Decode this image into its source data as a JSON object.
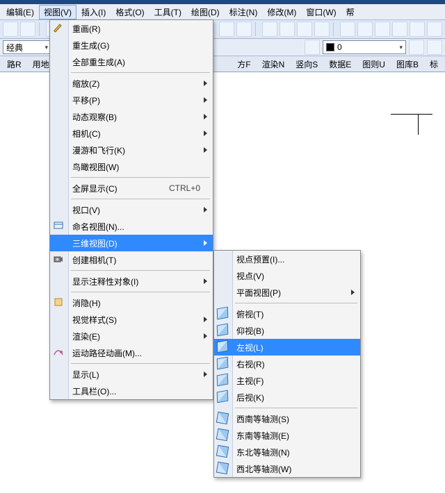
{
  "menubar": {
    "edit": "编辑(E)",
    "view": "视图(V)",
    "insert": "插入(I)",
    "format": "格式(O)",
    "tools": "工具(T)",
    "draw": "绘图(D)",
    "dim": "标注(N)",
    "modify": "修改(M)",
    "window": "窗口(W)",
    "help": "帮"
  },
  "layer": {
    "style_combo": "经典",
    "color_value": "0"
  },
  "tabs": {
    "t0": "路R",
    "t1": "用地",
    "t2": "方F",
    "t3": "渲染N",
    "t4": "竖向S",
    "t5": "数据E",
    "t6": "图则U",
    "t7": "图库B",
    "t8": "标"
  },
  "view_menu": {
    "redraw": "重画(R)",
    "regen": "重生成(G)",
    "regen_all": "全部重生成(A)",
    "zoom": "缩放(Z)",
    "pan": "平移(P)",
    "orbit": "动态观察(B)",
    "camera": "相机(C)",
    "walkfly": "漫游和飞行(K)",
    "birdview": "鸟瞰视图(W)",
    "fullscreen": "全屏显示(C)",
    "fullscreen_sc": "CTRL+0",
    "viewport": "视口(V)",
    "named_view": "命名视图(N)...",
    "three_d": "三维视图(D)",
    "create_cam": "创建相机(T)",
    "anno_obj": "显示注释性对象(I)",
    "hide": "消隐(H)",
    "vstyle": "视觉样式(S)",
    "render": "渲染(E)",
    "motion": "运动路径动画(M)...",
    "display": "显示(L)",
    "toolbars": "工具栏(O)..."
  },
  "sub_3d": {
    "preset": "视点预置(I)...",
    "viewpoint": "视点(V)",
    "plan": "平面视图(P)",
    "top": "俯视(T)",
    "bottom": "仰视(B)",
    "left": "左视(L)",
    "right": "右视(R)",
    "front": "主视(F)",
    "back": "后视(K)",
    "sw": "西南等轴测(S)",
    "se": "东南等轴测(E)",
    "ne": "东北等轴测(N)",
    "nw": "西北等轴测(W)"
  }
}
